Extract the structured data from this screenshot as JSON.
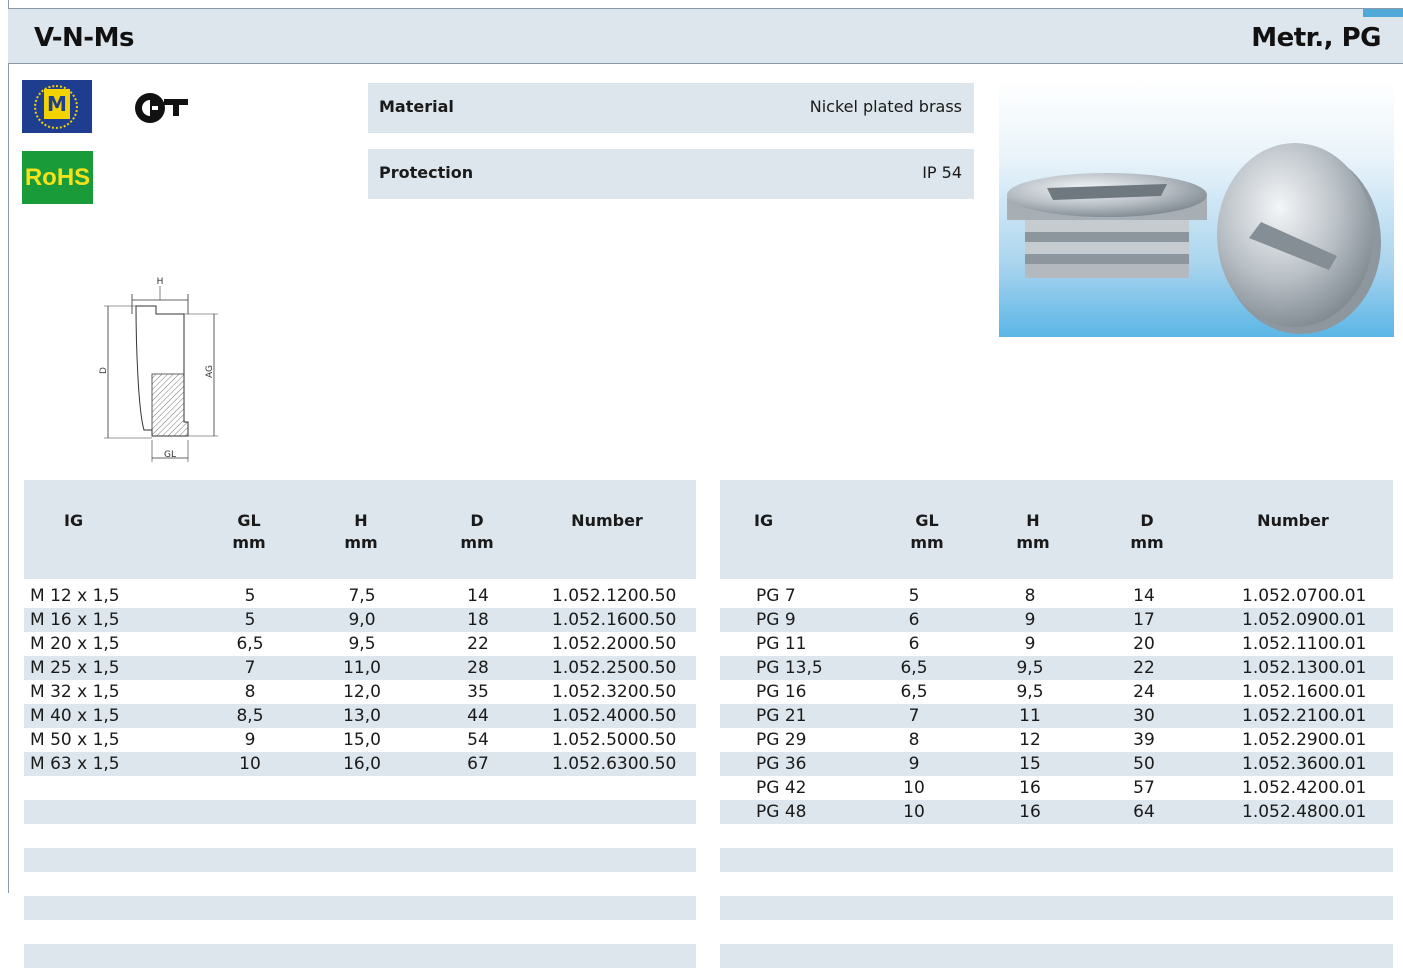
{
  "header": {
    "title": "V-N-Ms",
    "right": "Metr., PG"
  },
  "certifications": [
    {
      "name": "ex-m-mark",
      "label": "M"
    },
    {
      "name": "gost-r-mark",
      "label": "PCT"
    },
    {
      "name": "rohs-badge",
      "label": "RoHS"
    }
  ],
  "specs": [
    {
      "key": "Material",
      "value": "Nickel plated brass"
    },
    {
      "key": "Protection",
      "value": "IP 54"
    }
  ],
  "drawing": {
    "h": "H",
    "d": "D",
    "ag": "AG",
    "gl": "GL"
  },
  "colors": {
    "header_bg": "#dce6ec",
    "accent": "#4fa8d8",
    "rohs_bg": "#1a9b3a",
    "rohs_text": "#f4e21a",
    "eu_blue": "#1e3d8f"
  },
  "table_left": {
    "headers": [
      {
        "label": "IG",
        "unit": ""
      },
      {
        "label": "GL",
        "unit": "mm"
      },
      {
        "label": "H",
        "unit": "mm"
      },
      {
        "label": "D",
        "unit": "mm"
      },
      {
        "label": "Number",
        "unit": ""
      }
    ],
    "rows": [
      [
        "M 12 x 1,5",
        "5",
        "7,5",
        "14",
        "1.052.1200.50"
      ],
      [
        "M 16 x 1,5",
        "5",
        "9,0",
        "18",
        "1.052.1600.50"
      ],
      [
        "M 20 x 1,5",
        "6,5",
        "9,5",
        "22",
        "1.052.2000.50"
      ],
      [
        "M 25 x 1,5",
        "7",
        "11,0",
        "28",
        "1.052.2500.50"
      ],
      [
        "M 32 x 1,5",
        "8",
        "12,0",
        "35",
        "1.052.3200.50"
      ],
      [
        "M 40 x 1,5",
        "8,5",
        "13,0",
        "44",
        "1.052.4000.50"
      ],
      [
        "M 50 x 1,5",
        "9",
        "15,0",
        "54",
        "1.052.5000.50"
      ],
      [
        "M 63 x 1,5",
        "10",
        "16,0",
        "67",
        "1.052.6300.50"
      ]
    ]
  },
  "table_right": {
    "headers": [
      {
        "label": "IG",
        "unit": ""
      },
      {
        "label": "GL",
        "unit": "mm"
      },
      {
        "label": "H",
        "unit": "mm"
      },
      {
        "label": "D",
        "unit": "mm"
      },
      {
        "label": "Number",
        "unit": ""
      }
    ],
    "rows": [
      [
        "PG 7",
        "5",
        "8",
        "14",
        "1.052.0700.01"
      ],
      [
        "PG 9",
        "6",
        "9",
        "17",
        "1.052.0900.01"
      ],
      [
        "PG 11",
        "6",
        "9",
        "20",
        "1.052.1100.01"
      ],
      [
        "PG 13,5",
        "6,5",
        "9,5",
        "22",
        "1.052.1300.01"
      ],
      [
        "PG 16",
        "6,5",
        "9,5",
        "24",
        "1.052.1600.01"
      ],
      [
        "PG 21",
        "7",
        "11",
        "30",
        "1.052.2100.01"
      ],
      [
        "PG 29",
        "8",
        "12",
        "39",
        "1.052.2900.01"
      ],
      [
        "PG 36",
        "9",
        "15",
        "50",
        "1.052.3600.01"
      ],
      [
        "PG 42",
        "10",
        "16",
        "57",
        "1.052.4200.01"
      ],
      [
        "PG 48",
        "10",
        "16",
        "64",
        "1.052.4800.01"
      ]
    ]
  }
}
